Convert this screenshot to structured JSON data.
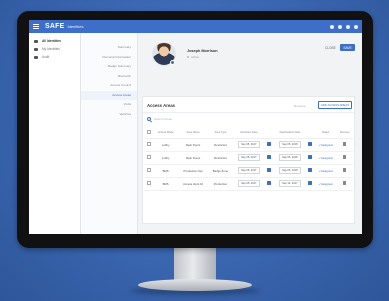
{
  "app": {
    "brand": "SAFE",
    "section": "Identities"
  },
  "leftnav": {
    "items": [
      {
        "label": "All Identities",
        "active": true
      },
      {
        "label": "My Identities",
        "active": false
      },
      {
        "label": "Audit",
        "active": false
      }
    ]
  },
  "subnav": {
    "items": [
      {
        "label": "Summary",
        "active": false
      },
      {
        "label": "Personal Information",
        "active": false
      },
      {
        "label": "Badge Summary",
        "active": false
      },
      {
        "label": "Biometric",
        "active": false
      },
      {
        "label": "Access Control",
        "active": false
      },
      {
        "label": "Access Areas",
        "active": true
      },
      {
        "label": "Visits",
        "active": false
      },
      {
        "label": "Vehicles",
        "active": false
      }
    ]
  },
  "profile": {
    "name": "Joseph Morrison",
    "status": "Active",
    "close_label": "CLOSE",
    "save_label": "SAVE"
  },
  "access": {
    "title": "Access Areas",
    "remove_label": "Remove",
    "add_label": "ADD ACCESS AREAS",
    "search_placeholder": "Search Areas",
    "columns": [
      "Access Mode",
      "Area Name",
      "Area Type",
      "Activation Date",
      "Deactivation Date",
      "Status",
      "Remove"
    ],
    "rows": [
      {
        "mode": "Lobby",
        "area": "Main Doors",
        "type": "Restricted",
        "start": "Sep 05, 2017",
        "end": "Sep 05, 2018",
        "status": "Assigned"
      },
      {
        "mode": "Lobby",
        "area": "Main Doors",
        "type": "Restricted",
        "start": "Sep 05, 2017",
        "end": "Sep 05, 2018",
        "status": "Assigned"
      },
      {
        "mode": "BMS",
        "area": "Production Ops",
        "type": "Badge Zone",
        "start": "Sep 05, 2017",
        "end": "Sep 05, 2018",
        "status": "Assigned"
      },
      {
        "mode": "BMS",
        "area": "Access Ident.16",
        "type": "Production",
        "start": "Sep 05, 2017",
        "end": "Sep 14, 2017",
        "status": "Assigned"
      }
    ]
  },
  "colors": {
    "accent": "#3d6fc9",
    "background": "#3a66b0"
  }
}
